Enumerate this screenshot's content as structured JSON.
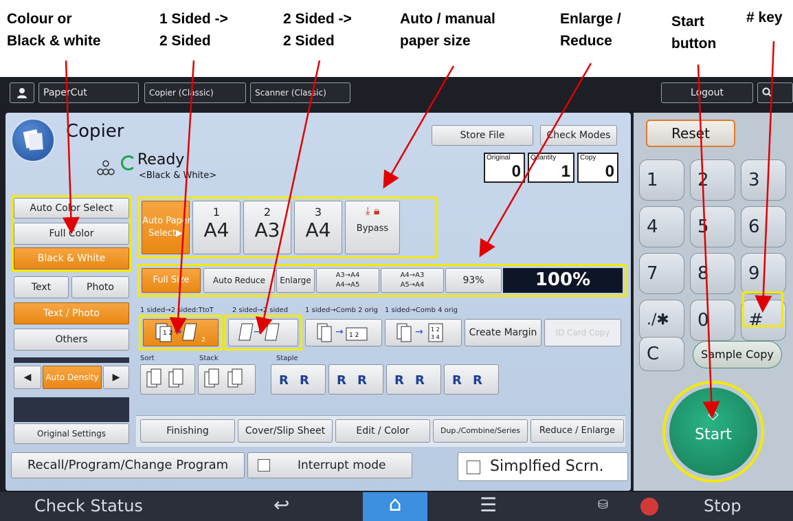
{
  "annotations": {
    "colour_bw": [
      "Colour or",
      "Black & white"
    ],
    "one_to_two": [
      "1 Sided ->",
      "2 Sided"
    ],
    "two_to_two": [
      "2 Sided ->",
      "2 Sided"
    ],
    "paper_size": [
      "Auto / manual",
      "paper size"
    ],
    "enlarge": [
      "Enlarge /",
      "Reduce"
    ],
    "start": [
      "Start",
      "button"
    ],
    "hash_key": "# key"
  },
  "topbar": {
    "papercut": "PaperCut",
    "copier_classic": "Copier (Classic)",
    "scanner_classic": "Scanner (Classic)",
    "logout": "Logout"
  },
  "header": {
    "title": "Copier",
    "store_file": "Store File",
    "check_modes": "Check Modes",
    "status": "Ready",
    "substatus": "<Black & White>",
    "counters": [
      {
        "label": "Original",
        "value": "0"
      },
      {
        "label": "Quantity",
        "value": "1"
      },
      {
        "label": "Copy",
        "value": "0"
      }
    ]
  },
  "color_modes": {
    "auto": "Auto Color Select",
    "full": "Full Color",
    "bw": "Black & White"
  },
  "original_type": {
    "text": "Text",
    "photo": "Photo",
    "text_photo": "Text / Photo",
    "others": "Others",
    "density": "Auto Density",
    "settings": "Original Settings"
  },
  "paper": {
    "auto_select": [
      "Auto Paper",
      "Select▶"
    ],
    "trays": [
      {
        "num": "1",
        "size": "A4"
      },
      {
        "num": "2",
        "size": "A3"
      },
      {
        "num": "3",
        "size": "A4"
      }
    ],
    "bypass": "Bypass"
  },
  "ratio": {
    "full_size": "Full Size",
    "auto_reduce": "Auto Reduce",
    "enlarge": "Enlarge",
    "preset1": [
      "A3→A4",
      "A4→A5"
    ],
    "preset2": [
      "A4→A3",
      "A5→A4"
    ],
    "pct93": "93%",
    "current": "100%"
  },
  "duplex": {
    "labels": [
      "1 sided→2 sided:TtoT",
      "2 sided→2 sided",
      "1 sided→Comb 2 orig",
      "1 sided→Comb 4 orig"
    ],
    "create_margin": "Create Margin",
    "id_card": "ID Card Copy"
  },
  "finishing": {
    "sort": "Sort",
    "stack": "Stack",
    "staple": "Staple"
  },
  "tabs": [
    "Finishing",
    "Cover/Slip Sheet",
    "Edit / Color",
    "Dup./Combine/Series",
    "Reduce / Enlarge"
  ],
  "bottom_row": {
    "recall": "Recall/Program/Change Program",
    "interrupt": "Interrupt mode",
    "simplified": "Simplfied Scrn."
  },
  "keypad": {
    "reset": "Reset",
    "keys": [
      "1",
      "2",
      "3",
      "4",
      "5",
      "6",
      "7",
      "8",
      "9",
      "./✱",
      "0",
      "#"
    ],
    "clear": "C",
    "sample_copy": "Sample Copy",
    "start": "Start"
  },
  "footer": {
    "check_status": "Check Status",
    "stop": "Stop"
  },
  "colors": {
    "accent_orange": "#f08a10",
    "highlight_yellow": "#f4ea00",
    "arrow_red": "#e00000",
    "start_green": "#1d9a6c"
  }
}
